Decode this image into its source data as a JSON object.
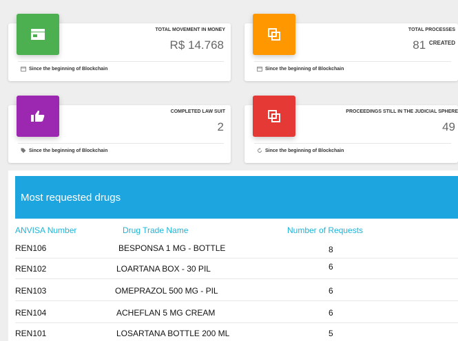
{
  "cards": [
    {
      "title": "TOTAL MOVEMENT IN MONEY",
      "value": "R$ 14.768",
      "suffix": "",
      "footer": "Since the beginning of Blockchain",
      "color": "#4caf50",
      "icon": "store-icon",
      "footer_icon": "calendar-icon"
    },
    {
      "title": "TOTAL PROCESSES",
      "value": "81",
      "suffix": "CREATED",
      "footer": "Since the beginning of Blockchain",
      "color": "#ff9800",
      "icon": "copy-icon",
      "footer_icon": "calendar-icon"
    },
    {
      "title": "COMPLETED LAW SUIT",
      "value": "2",
      "suffix": "",
      "footer": "Since the beginning of Blockchain",
      "color": "#9c27b0",
      "icon": "thumbs-up-icon",
      "footer_icon": "tag-icon"
    },
    {
      "title": "PROCEEDINGS STILL IN THE JUDICIAL SPHERE",
      "value": "49",
      "suffix": "",
      "footer": "Since the beginning of Blockchain",
      "color": "#e53935",
      "icon": "copy-icon",
      "footer_icon": "refresh-icon"
    }
  ],
  "table": {
    "title": "Most requested drugs",
    "columns": [
      "ANVISA Number",
      "Drug Trade Name",
      "Number of Requests"
    ],
    "rows": [
      [
        "REN106",
        "BESPONSA 1 MG - BOTTLE",
        "8"
      ],
      [
        "REN102",
        "LOARTANA BOX - 30 PIL",
        "6"
      ],
      [
        "REN103",
        "OMEPRAZOL 500 MG - PIL",
        "6"
      ],
      [
        "REN104",
        "ACHEFLAN 5 MG  CREAM",
        "6"
      ],
      [
        "REN101",
        "LOSARTANA BOTTLE 200 ML",
        "5"
      ]
    ]
  }
}
